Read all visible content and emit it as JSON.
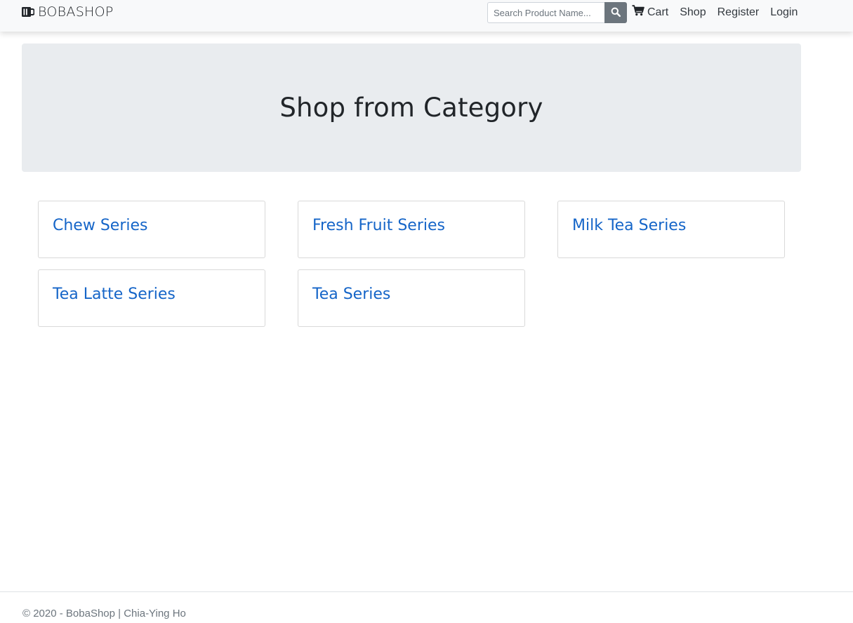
{
  "navbar": {
    "brand": "BOBASHOP",
    "search": {
      "placeholder": "Search Product Name...",
      "value": ""
    },
    "links": {
      "cart": "Cart",
      "shop": "Shop",
      "register": "Register",
      "login": "Login"
    }
  },
  "hero": {
    "title": "Shop from Category"
  },
  "categories": [
    {
      "label": "Chew Series"
    },
    {
      "label": "Fresh Fruit Series"
    },
    {
      "label": "Milk Tea Series"
    },
    {
      "label": "Tea Latte Series"
    },
    {
      "label": "Tea Series"
    }
  ],
  "footer": {
    "text": "© 2020 - BobaShop | Chia-Ying Ho"
  },
  "colors": {
    "navbar_bg": "#f8f9fa",
    "hero_bg": "#e9ecef",
    "link_blue": "#1565c8",
    "search_button_bg": "#6c757d"
  },
  "icons": {
    "brand": "mug-icon",
    "search": "search-icon",
    "cart": "cart-icon"
  }
}
